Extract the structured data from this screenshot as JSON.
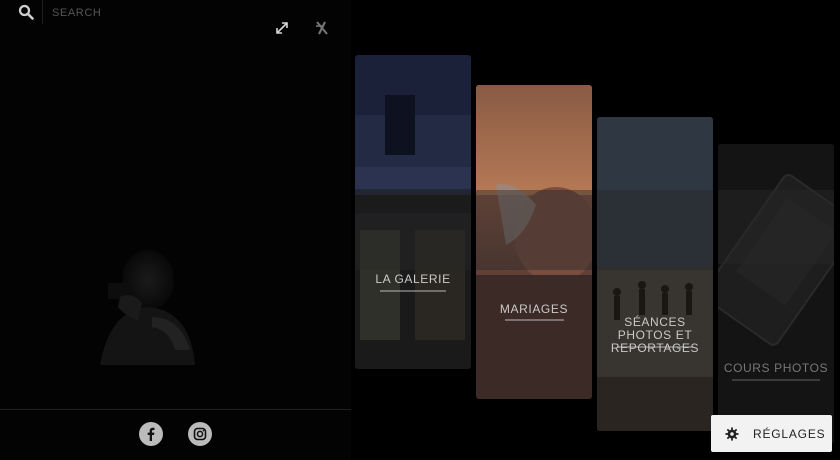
{
  "search": {
    "placeholder": "SEARCH"
  },
  "gallery": {
    "panels": [
      {
        "label": "LA GALERIE"
      },
      {
        "label": "MARIAGES"
      },
      {
        "label": "SÉANCES PHOTOS ET REPORTAGES"
      },
      {
        "label": "COURS PHOTOS"
      }
    ]
  },
  "settings": {
    "label": "RÉGLAGES"
  },
  "icons": {
    "search": "search-icon",
    "expand": "expand-icon",
    "close": "close-icon",
    "facebook": "facebook-icon",
    "instagram": "instagram-icon",
    "gear": "gear-icon"
  },
  "colors": {
    "background": "#000000",
    "settings_bg": "#f2f2f2"
  }
}
